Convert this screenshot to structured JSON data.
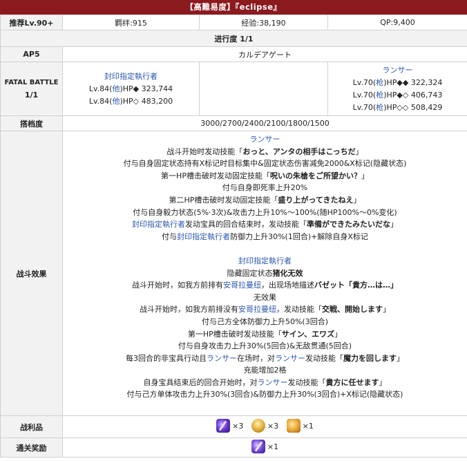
{
  "header": {
    "title": "【高難易度】『eclipse』"
  },
  "stats": {
    "recommend": "推荐Lv.90+",
    "bond": "羁绊:915",
    "exp": "经验:38,190",
    "qp": "QP:9,400"
  },
  "progress": "进行度 1/1",
  "ap": {
    "label": "AP5",
    "value": "カルデアゲート"
  },
  "fatal": {
    "label_line1": "FATAL BATTLE",
    "label_line2": "1/1",
    "left": {
      "name": "封印指定執行者",
      "lines": [
        {
          "lv": "Lv.84(",
          "cls": "他",
          "rest": ")HP◆ 323,744"
        },
        {
          "lv": "Lv.84(",
          "cls": "他",
          "rest": ")HP◇ 483,200"
        }
      ]
    },
    "right": {
      "name": "ランサー",
      "lines": [
        {
          "lv": "Lv.70(",
          "cls": "枪",
          "rest": ")HP◆◆ 322,324"
        },
        {
          "lv": "Lv.70(",
          "cls": "枪",
          "rest": ")HP◆◇ 406,743"
        },
        {
          "lv": "Lv.70(",
          "cls": "枪",
          "rest": ")HP◇◇ 508,429"
        }
      ]
    }
  },
  "support": {
    "label": "搭档度",
    "value": "3000/2700/2400/2100/1800/1500"
  },
  "battle": {
    "label": "战斗效果",
    "lancer_title": "ランサー",
    "l1a": "战斗开始时发动技能「",
    "l1b": "おっと、アンタの相手はこっちだ",
    "l1c": "」",
    "l2": "付与自身固定状态持有X标记时目标集中&固定状态伤害减免2000&X标记(隐藏状态)",
    "l3a": "第一HP槽击破时发动固定技能「",
    "l3b": "呪いの朱槍をご所望かい？",
    "l3c": "」",
    "l4": "付与自身即死率上升20%",
    "l5a": "第二HP槽击破时发动固定技能「",
    "l5b": "盛り上がってきたねえ",
    "l5c": "」",
    "l6": "付与自身毅力状态(5%·3次)&攻击力上升10%～100%(随HP100%～0%变化)",
    "l7a": "封印指定執行者",
    "l7b": "发动宝具的回合结束时，发动技能「",
    "l7c": "準備ができたみたいだな",
    "l7d": "」",
    "l8a": "付与",
    "l8b": "封印指定執行者",
    "l8c": "防御力上升30%(1回合)+解除自身X标记",
    "exec_title": "封印指定執行者",
    "e1a": "隐藏固定状态",
    "e1b": "猪化无效",
    "e2a": "战斗开始时，如我方前排有",
    "e2b": "安哥拉曼纽",
    "e2c": "，出现场地描述",
    "e2d": "バゼット「貴方…は…」",
    "e3": "无效果",
    "e4a": "战斗开始时，如我方前排没有",
    "e4b": "安哥拉曼纽",
    "e4c": "，发动技能「",
    "e4d": "交戦、開始します",
    "e4e": "」",
    "e5": "付与己方全体防御力上升50%(3回合)",
    "e6a": "第一HP槽击破时发动技能「",
    "e6b": "サイン、エワズ",
    "e6c": "」",
    "e7": "付与自身攻击力上升30%(5回合)&无敌贯通(5回合)",
    "e8a": "每3回合的非宝具行动且",
    "e8b": "ランサー",
    "e8c": "在场时，对",
    "e8d": "ランサー",
    "e8e": "发动技能「",
    "e8f": "魔力を回します",
    "e8g": "」",
    "e9": "充能增加2格",
    "e10a": "自身宝具结束后的回合开始时，对",
    "e10b": "ランサー",
    "e10c": "发动技能「",
    "e10d": "貴方に任せます",
    "e10e": "」",
    "e11": "付与己方单体攻击力上升30%(3回合)&防御力上升30%(3回合)+X标记(隐藏状态)"
  },
  "drops": {
    "label": "战利品",
    "items": [
      {
        "icon": "lancer-piece-icon",
        "qty": "×3"
      },
      {
        "icon": "golden-egg-icon",
        "qty": "×3"
      },
      {
        "icon": "golden-stone-icon",
        "qty": "×1"
      }
    ]
  },
  "reward": {
    "label": "通关奖励",
    "items": [
      {
        "icon": "reward-piece-icon",
        "qty": "×1"
      }
    ]
  }
}
